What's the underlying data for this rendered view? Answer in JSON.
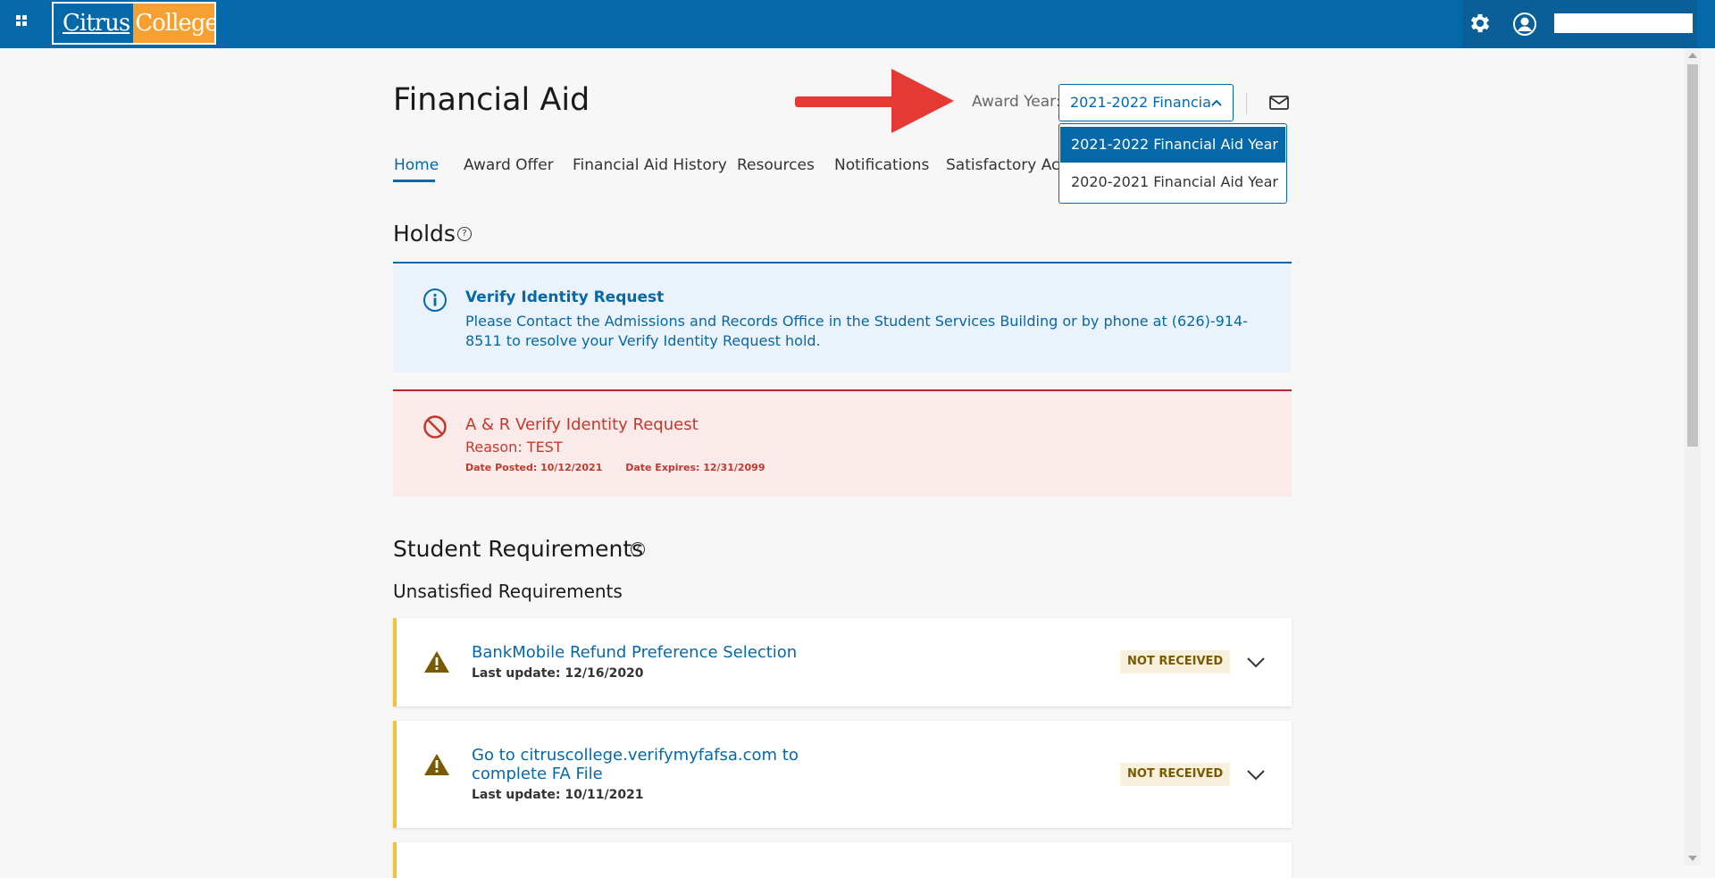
{
  "header": {
    "logo_part1": "Citrus",
    "logo_part2": "College"
  },
  "page": {
    "title": "Financial Aid"
  },
  "award_year": {
    "label": "Award Year:",
    "selected": "2021-2022 Financia...",
    "options": [
      "2021-2022 Financial Aid Year",
      "2020-2021 Financial Aid Year"
    ]
  },
  "tabs": [
    "Home",
    "Award Offer",
    "Financial Aid History",
    "Resources",
    "Notifications",
    "Satisfactory Acad"
  ],
  "holds": {
    "title": "Holds",
    "help": "?",
    "info": {
      "title": "Verify Identity Request",
      "message": "Please Contact the Admissions and Records Office in the Student Services Building or by phone at (626)-914-8511 to resolve your Verify Identity Request hold."
    },
    "error": {
      "title": "A & R Verify Identity Request",
      "reason": "Reason: TEST",
      "date_posted": "Date Posted: 10/12/2021",
      "date_expires": "Date Expires: 12/31/2099"
    }
  },
  "requirements": {
    "title": "Student Requirements",
    "help": "?",
    "subtitle": "Unsatisfied Requirements",
    "items": [
      {
        "title": "BankMobile Refund Preference Selection",
        "updated": "Last update: 12/16/2020",
        "status": "NOT RECEIVED"
      },
      {
        "title_line1": "Go to citruscollege.verifymyfafsa.com to",
        "title_line2": "complete FA File",
        "updated": "Last update: 10/11/2021",
        "status": "NOT RECEIVED"
      }
    ]
  },
  "colors": {
    "brand_blue": "#0568a8",
    "brand_orange": "#f6a031",
    "error_red": "#c0392b",
    "warning_yellow": "#f0c43a"
  }
}
